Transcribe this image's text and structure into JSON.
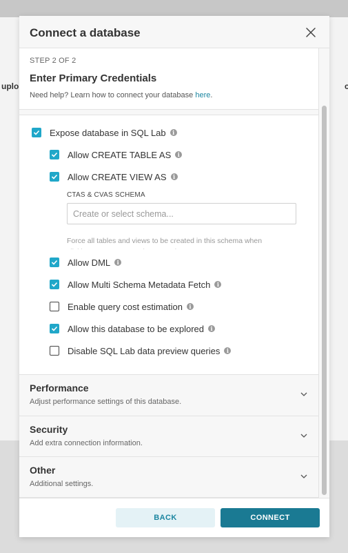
{
  "background": {
    "left_text": "uplo",
    "right_text": "c"
  },
  "modal": {
    "title": "Connect a database",
    "close_icon": "close-icon"
  },
  "step": {
    "label": "STEP 2 OF 2",
    "title": "Enter Primary Credentials",
    "help_prefix": "Need help? Learn how to connect your database ",
    "help_link": "here",
    "help_suffix": "."
  },
  "options": {
    "expose_sql_lab": {
      "label": "Expose database in SQL Lab",
      "checked": true
    },
    "create_table_as": {
      "label": "Allow CREATE TABLE AS",
      "checked": true
    },
    "create_view_as": {
      "label": "Allow CREATE VIEW AS",
      "checked": true
    },
    "schema_label": "CTAS & CVAS SCHEMA",
    "schema_placeholder": "Create or select schema...",
    "schema_help": "Force all tables and views to be created in this schema when clicking CTAS or CVAS in SQL Lab.",
    "allow_dml": {
      "label": "Allow DML",
      "checked": true
    },
    "multi_schema": {
      "label": "Allow Multi Schema Metadata Fetch",
      "checked": true
    },
    "cost_estimation": {
      "label": "Enable query cost estimation",
      "checked": false
    },
    "explore": {
      "label": "Allow this database to be explored",
      "checked": true
    },
    "disable_preview": {
      "label": "Disable SQL Lab data preview queries",
      "checked": false
    }
  },
  "sections": {
    "performance": {
      "title": "Performance",
      "subtitle": "Adjust performance settings of this database."
    },
    "security": {
      "title": "Security",
      "subtitle": "Add extra connection information."
    },
    "other": {
      "title": "Other",
      "subtitle": "Additional settings."
    }
  },
  "footer": {
    "back_label": "BACK",
    "connect_label": "CONNECT"
  },
  "colors": {
    "accent": "#20a7c9",
    "primary_button": "#1a7a93",
    "secondary_button_bg": "#e4f2f6"
  }
}
